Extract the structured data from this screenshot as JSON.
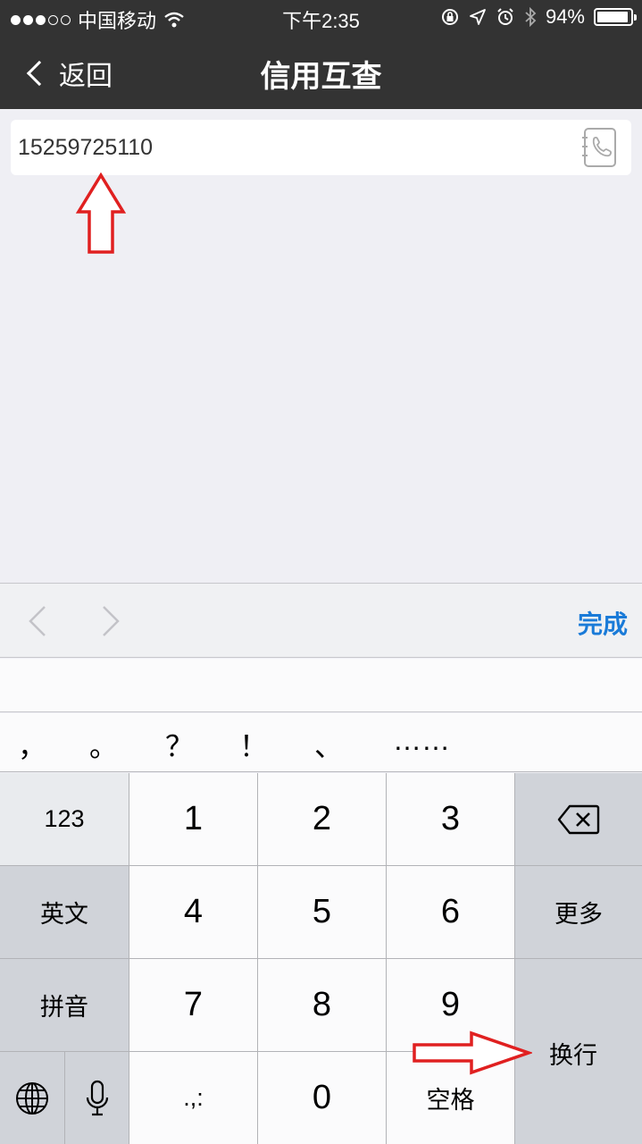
{
  "status_bar": {
    "carrier": "中国移动",
    "time": "下午2:35",
    "battery_percent": "94%",
    "battery_level": 0.94,
    "icons": [
      "signal-dots-icon",
      "wifi-icon",
      "orientation-lock-icon",
      "location-icon",
      "alarm-icon",
      "bluetooth-icon",
      "battery-icon"
    ]
  },
  "nav": {
    "back_label": "返回",
    "title": "信用互查"
  },
  "input": {
    "value": "15259725110",
    "contact_icon": "contact-book-icon"
  },
  "accessory": {
    "done_label": "完成"
  },
  "punctuation": [
    "，",
    "。",
    "？",
    "！",
    "、",
    "……"
  ],
  "keyboard": {
    "k123": "123",
    "english": "英文",
    "pinyin": "拼音",
    "more": "更多",
    "enter": "换行",
    "space": "空格",
    "punct": ".,:",
    "digits": [
      "1",
      "2",
      "3",
      "4",
      "5",
      "6",
      "7",
      "8",
      "9",
      "0"
    ]
  },
  "colors": {
    "bar_bg": "#333333",
    "accent": "#1a7bd8",
    "annotation": "#e02020"
  }
}
